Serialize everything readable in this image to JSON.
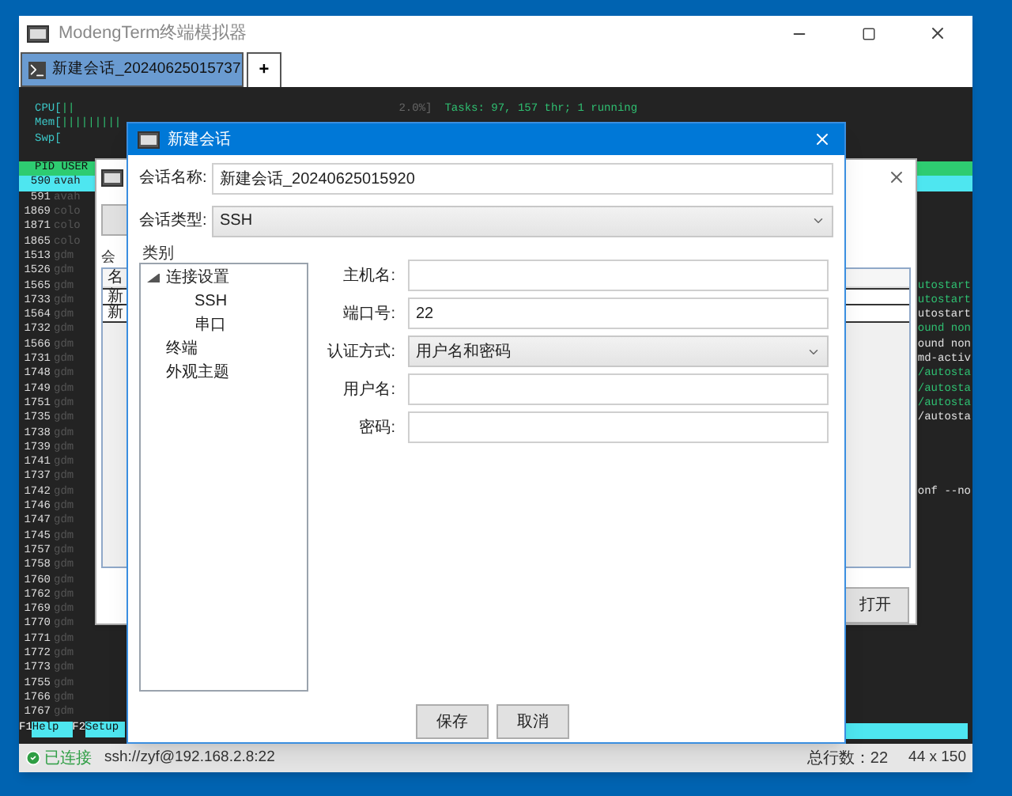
{
  "window": {
    "title": "ModengTerm终端模拟器"
  },
  "tabs": [
    {
      "label": "新建会话_20240625015737",
      "selected": true
    },
    {
      "label": "+",
      "selected": false
    }
  ],
  "terminal": {
    "meters": [
      {
        "label": "CPU[",
        "bar": "||"
      },
      {
        "label": "Mem[",
        "bar": "|||||||||"
      },
      {
        "label": "Swp["
      }
    ],
    "cpu_reading": "2.0%]",
    "tasks": "Tasks: 97, 157 thr; 1 running",
    "header": "PID USER",
    "rows": [
      {
        "pid": "590",
        "user": "avah",
        "selected": true
      },
      {
        "pid": "591",
        "user": "avah",
        "selected": false
      },
      {
        "pid": "1869",
        "user": "colo",
        "selected": false
      },
      {
        "pid": "1871",
        "user": "colo",
        "selected": false
      },
      {
        "pid": "1865",
        "user": "colo",
        "selected": false
      },
      {
        "pid": "1513",
        "user": "gdm",
        "selected": false
      },
      {
        "pid": "1526",
        "user": "gdm",
        "selected": false
      },
      {
        "pid": "1565",
        "user": "gdm",
        "selected": false,
        "tail": {
          "text": "utostart",
          "color": "#2fbf71"
        }
      },
      {
        "pid": "1733",
        "user": "gdm",
        "selected": false,
        "tail": {
          "text": "utostart",
          "color": "#2fbf71"
        }
      },
      {
        "pid": "1564",
        "user": "gdm",
        "selected": false,
        "tail": {
          "text": "utostart",
          "color": "#e0e0e0"
        }
      },
      {
        "pid": "1732",
        "user": "gdm",
        "selected": false,
        "tail": {
          "text": "ound non",
          "color": "#2fbf71"
        }
      },
      {
        "pid": "1566",
        "user": "gdm",
        "selected": false,
        "tail": {
          "text": "ound non",
          "color": "#e0e0e0"
        }
      },
      {
        "pid": "1731",
        "user": "gdm",
        "selected": false,
        "tail": {
          "text": "md-activ",
          "color": "#e0e0e0"
        }
      },
      {
        "pid": "1748",
        "user": "gdm",
        "selected": false,
        "tail": {
          "text": "/autosta",
          "color": "#2fbf71"
        }
      },
      {
        "pid": "1749",
        "user": "gdm",
        "selected": false,
        "tail": {
          "text": "/autosta",
          "color": "#2fbf71"
        }
      },
      {
        "pid": "1751",
        "user": "gdm",
        "selected": false,
        "tail": {
          "text": "/autosta",
          "color": "#2fbf71"
        }
      },
      {
        "pid": "1735",
        "user": "gdm",
        "selected": false,
        "tail": {
          "text": "/autosta",
          "color": "#e0e0e0"
        }
      },
      {
        "pid": "1738",
        "user": "gdm",
        "selected": false
      },
      {
        "pid": "1739",
        "user": "gdm",
        "selected": false
      },
      {
        "pid": "1741",
        "user": "gdm",
        "selected": false
      },
      {
        "pid": "1737",
        "user": "gdm",
        "selected": false
      },
      {
        "pid": "1742",
        "user": "gdm",
        "selected": false,
        "tail": {
          "text": "onf --no",
          "color": "#e0e0e0"
        }
      },
      {
        "pid": "1746",
        "user": "gdm",
        "selected": false
      },
      {
        "pid": "1747",
        "user": "gdm",
        "selected": false
      },
      {
        "pid": "1745",
        "user": "gdm",
        "selected": false
      },
      {
        "pid": "1757",
        "user": "gdm",
        "selected": false
      },
      {
        "pid": "1758",
        "user": "gdm",
        "selected": false
      },
      {
        "pid": "1760",
        "user": "gdm",
        "selected": false
      },
      {
        "pid": "1762",
        "user": "gdm",
        "selected": false
      },
      {
        "pid": "1769",
        "user": "gdm",
        "selected": false
      },
      {
        "pid": "1770",
        "user": "gdm",
        "selected": false
      },
      {
        "pid": "1771",
        "user": "gdm",
        "selected": false
      },
      {
        "pid": "1772",
        "user": "gdm",
        "selected": false
      },
      {
        "pid": "1773",
        "user": "gdm",
        "selected": false
      },
      {
        "pid": "1755",
        "user": "gdm",
        "selected": false
      },
      {
        "pid": "1766",
        "user": "gdm",
        "selected": false
      },
      {
        "pid": "1767",
        "user": "gdm",
        "selected": false
      }
    ],
    "function_keys": [
      {
        "key": "F1",
        "label": "Help  "
      },
      {
        "key": "F2",
        "label": "Setup "
      }
    ]
  },
  "session_list_dialog": {
    "group_label": "会",
    "column_label": "名",
    "rows": [
      {
        "name": "新",
        "selected": true
      },
      {
        "name": "新",
        "selected": false
      }
    ],
    "open_button": "打开"
  },
  "new_session_dialog": {
    "title": "新建会话",
    "fields": [
      {
        "label": "会话名称:",
        "kind": "input",
        "value": "新建会话_20240625015920"
      },
      {
        "label": "会话类型:",
        "kind": "select",
        "value": "SSH"
      }
    ],
    "category_label": "类别",
    "tree": [
      {
        "label": "连接设置",
        "expanded": true,
        "children": [
          {
            "label": "SSH"
          },
          {
            "label": "串口"
          }
        ]
      },
      {
        "label": "终端"
      },
      {
        "label": "外观主题"
      }
    ],
    "form": [
      {
        "label": "主机名:",
        "kind": "input"
      },
      {
        "label": "端口号:",
        "kind": "input",
        "value": "22"
      },
      {
        "label": "认证方式:",
        "kind": "select",
        "value": "用户名和密码"
      },
      {
        "label": "用户名:",
        "kind": "input"
      },
      {
        "label": "密码:",
        "kind": "input"
      }
    ],
    "buttons": [
      "保存",
      "取消"
    ]
  },
  "status_bar": {
    "connection": "已连接",
    "connected": true,
    "address": "ssh://zyf@192.168.2.8:22",
    "line_count": "总行数：22",
    "size": "44 x 150"
  }
}
